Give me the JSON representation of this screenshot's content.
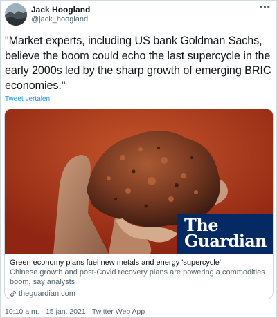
{
  "author": {
    "display_name": "Jack Hoogland",
    "handle": "@jack_hoogland"
  },
  "menu": {
    "more_icon": "more-icon",
    "more_glyph": "•••"
  },
  "tweet": {
    "text": "\"Market experts, including US bank Goldman Sachs, believe the boom could echo the last supercycle in the early 2000s led by the sharp growth of emerging BRIC economies.\"",
    "translate_label": "Tweet vertalen"
  },
  "card": {
    "image_alt": "Hand holding a lump of iron ore",
    "publisher_logo": {
      "the": "The",
      "name": "Guardian",
      "bg_color": "#052962"
    },
    "title": "Green economy plans fuel new metals and energy 'supercycle'",
    "description": "Chinese growth and post-Covid recovery plans are powering a commodities boom, say analysts",
    "domain": "theguardian.com"
  },
  "meta": {
    "time": "10:10 a.m.",
    "separator": "·",
    "date": "15 jan. 2021",
    "source": "Twitter Web App"
  },
  "colors": {
    "link_blue": "#1d9bf0",
    "secondary_text": "#536471",
    "border": "#cfd9de"
  }
}
